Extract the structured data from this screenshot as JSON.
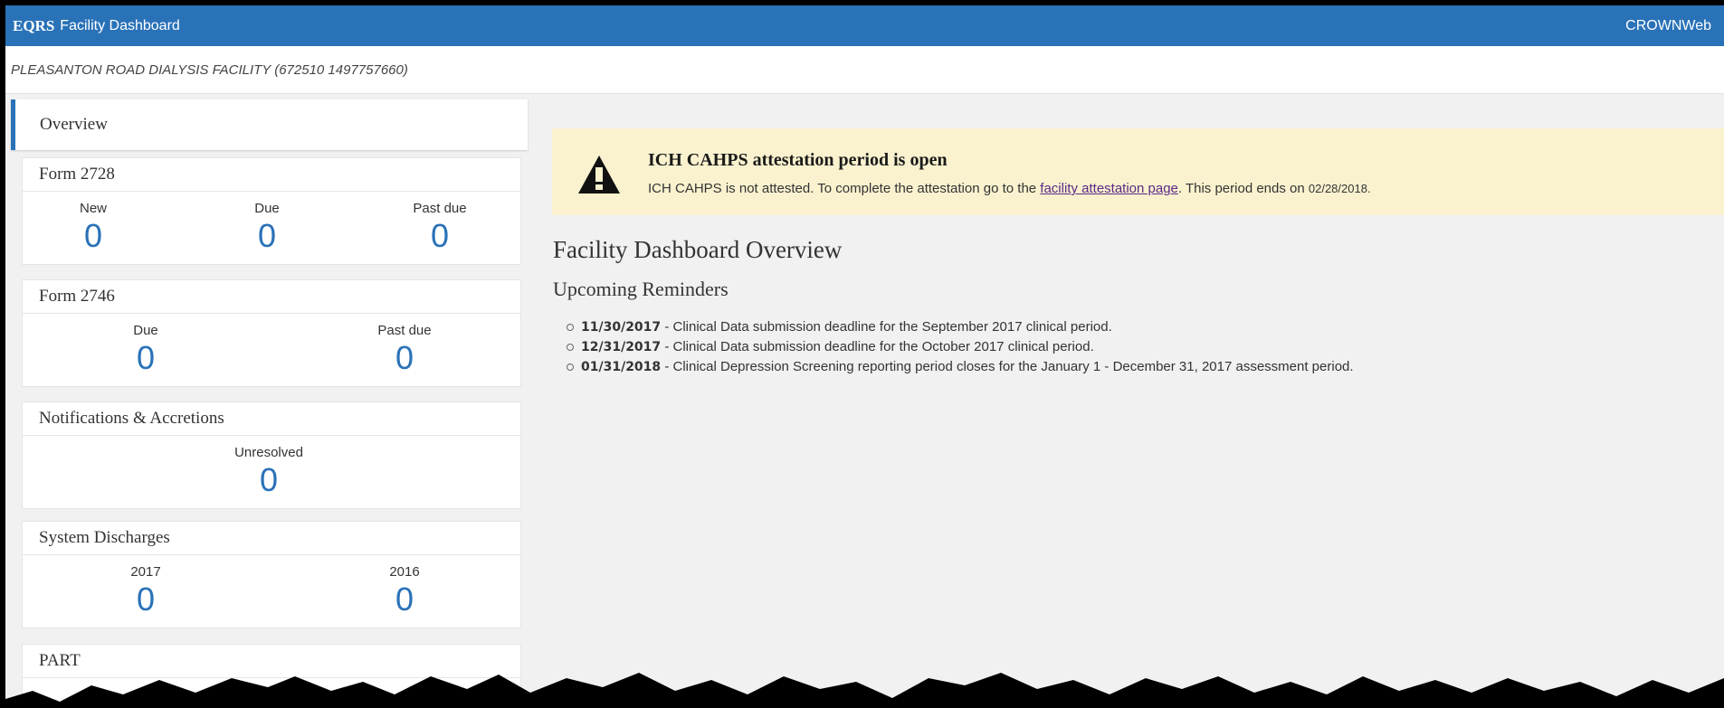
{
  "topbar": {
    "logo": "EQRS",
    "app_name": "Facility Dashboard",
    "right_label": "CROWNWeb"
  },
  "facility": {
    "name": "PLEASANTON ROAD DIALYSIS FACILITY (672510 1497757660)"
  },
  "sidebar": {
    "overview_label": "Overview",
    "cards": [
      {
        "title": "Form 2728",
        "stats": [
          {
            "label": "New",
            "value": "0"
          },
          {
            "label": "Due",
            "value": "0"
          },
          {
            "label": "Past due",
            "value": "0"
          }
        ]
      },
      {
        "title": "Form 2746",
        "stats": [
          {
            "label": "Due",
            "value": "0"
          },
          {
            "label": "Past due",
            "value": "0"
          }
        ]
      },
      {
        "title": "Notifications & Accretions",
        "stats": [
          {
            "label": "Unresolved",
            "value": "0"
          }
        ]
      },
      {
        "title": "System Discharges",
        "stats": [
          {
            "label": "2017",
            "value": "0"
          },
          {
            "label": "2016",
            "value": "0"
          }
        ]
      },
      {
        "title": "PART"
      }
    ]
  },
  "alert": {
    "title": "ICH CAHPS attestation period is open",
    "message_prefix": "ICH CAHPS is not attested. To complete the attestation go to the ",
    "link_text": "facility attestation page",
    "message_suffix": ". This period ends on ",
    "end_date": "02/28/2018."
  },
  "main": {
    "heading": "Facility Dashboard Overview",
    "subheading": "Upcoming Reminders",
    "reminders": [
      {
        "date": "11/30/2017",
        "text": " -  Clinical Data submission deadline for the September 2017 clinical period."
      },
      {
        "date": "12/31/2017",
        "text": " -  Clinical Data submission deadline for the October 2017 clinical period."
      },
      {
        "date": "01/31/2018",
        "text": " -  Clinical Depression Screening reporting period closes for the January 1 - December 31, 2017 assessment period."
      }
    ]
  }
}
